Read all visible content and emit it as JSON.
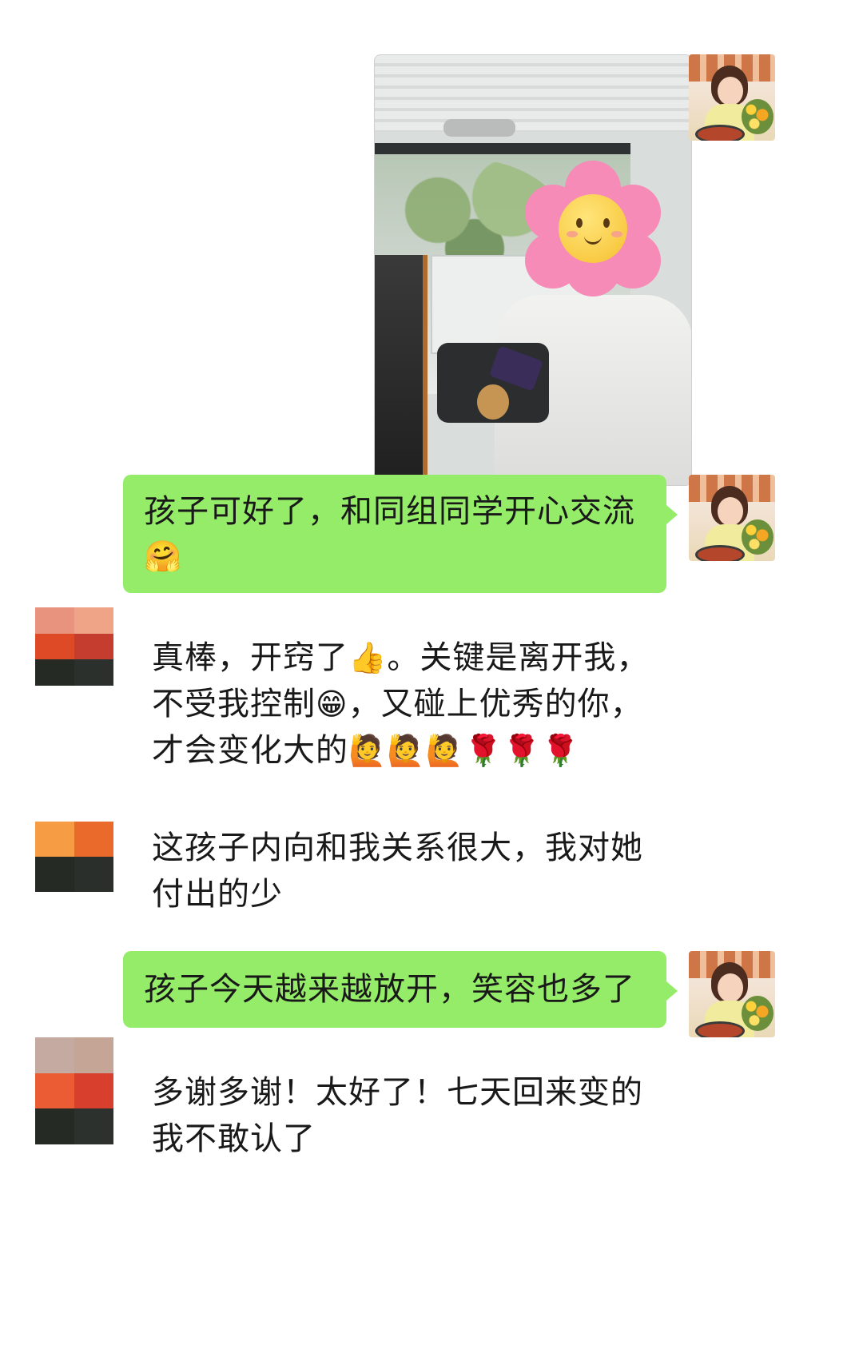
{
  "messages": {
    "m1_photo": {
      "alt": "photo"
    },
    "m2": {
      "text": "孩子可好了，和同组同学开心交流",
      "emoji": "🤗"
    },
    "m3": {
      "line1_a": "真棒，开窍了",
      "line1_emoji": "👍",
      "line1_b": "。关键是离开我，",
      "line2_a": "不受我控制",
      "line2_emoji": "😁",
      "line2_b": "，又碰上优秀的你，",
      "line3_a": "才会变化大的",
      "line3_emojis": "🙋🙋🙋🌹🌹🌹"
    },
    "m4": {
      "line1": "这孩子内向和我关系很大，我对她",
      "line2": "付出的少"
    },
    "m5": {
      "text": "孩子今天越来越放开，笑容也多了"
    },
    "m6": {
      "line1": "多谢多谢！太好了！七天回来变的",
      "line2": "我不敢认了"
    }
  },
  "colors": {
    "self_bubble": "#95ec69",
    "background": "#ffffff",
    "text": "#191919"
  },
  "avatars": {
    "friend1": [
      "#e8937e",
      "#efa487",
      "#de4a25",
      "#c43d2e",
      "#252a25",
      "#2c302c"
    ],
    "friend2": [
      "#f59c45",
      "#ea6a2c",
      "#262a24",
      "#2b2f2b"
    ],
    "friend3": [
      "#c4aaa0",
      "#c5a596",
      "#ec5c34",
      "#d8402d",
      "#252a25",
      "#2d312d"
    ]
  },
  "icons": {
    "self_avatar": "self-avatar-photo",
    "flower_sticker": "flower-face-sticker"
  }
}
